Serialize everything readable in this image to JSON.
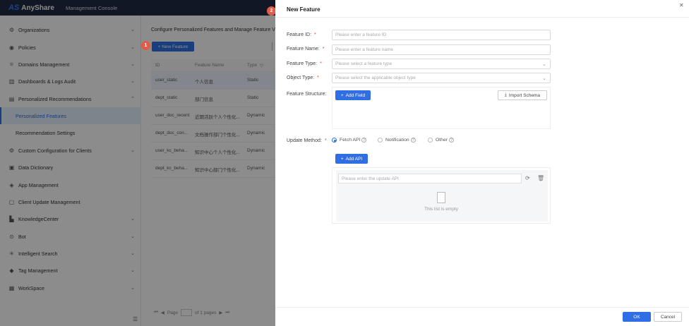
{
  "topbar": {
    "logo_mark": "AS",
    "brand": "AnyShare",
    "title": "Management Console"
  },
  "sidebar": {
    "items": [
      {
        "label": "Organizations",
        "icon": "organizations-icon",
        "expandable": true
      },
      {
        "label": "Policies",
        "icon": "policies-icon",
        "expandable": true
      },
      {
        "label": "Domains Management",
        "icon": "domains-icon",
        "expandable": true
      },
      {
        "label": "Dashboards & Logs Audit",
        "icon": "dashboard-icon",
        "expandable": true
      },
      {
        "label": "Personalized Recommendations",
        "icon": "recommendations-icon",
        "expandable": true,
        "expanded": true
      },
      {
        "label": "Personalized Features",
        "sub": true,
        "active": true
      },
      {
        "label": "Recommendation Settings",
        "sub": true
      },
      {
        "label": "Custom Configuration for Clients",
        "icon": "custom-config-icon",
        "expandable": true
      },
      {
        "label": "Data Dictionary",
        "icon": "dictionary-icon"
      },
      {
        "label": "App Management",
        "icon": "app-icon"
      },
      {
        "label": "Client Update Management",
        "icon": "client-update-icon"
      },
      {
        "label": "KnowledgeCenter",
        "icon": "knowledge-icon",
        "expandable": true
      },
      {
        "label": "Bot",
        "icon": "bot-icon",
        "expandable": true
      },
      {
        "label": "Intelligent Search",
        "icon": "search-icon",
        "expandable": true
      },
      {
        "label": "Tag Management",
        "icon": "tag-icon",
        "expandable": true
      },
      {
        "label": "WorkSpace",
        "icon": "workspace-icon",
        "expandable": true
      }
    ]
  },
  "main": {
    "heading": "Configure Personalized Features and Manage Feature V",
    "new_feature_label": "+ New Feature",
    "columns": [
      "ID",
      "Feature Name",
      "Type"
    ],
    "rows": [
      {
        "id": "user_static",
        "name": "个人信息",
        "type": "Static"
      },
      {
        "id": "dept_static",
        "name": "部门信息",
        "type": "Static"
      },
      {
        "id": "user_doc_recent",
        "name": "近期活跃个人个性化...",
        "type": "Dynamic"
      },
      {
        "id": "dept_doc_con...",
        "name": "文档操作部门个性化...",
        "type": "Dynamic"
      },
      {
        "id": "user_kc_beha...",
        "name": "知识中心个人个性化...",
        "type": "Dynamic"
      },
      {
        "id": "dept_kc_beha...",
        "name": "知识中心部门个性化...",
        "type": "Dynamic"
      }
    ],
    "pager": {
      "page_label": "Page",
      "of_label": "of 1 pages"
    }
  },
  "steps": {
    "one": "1",
    "two": "2"
  },
  "drawer": {
    "title": "New Feature",
    "fields": {
      "feature_id": {
        "label": "Feature ID:",
        "placeholder": "Please enter a feature ID"
      },
      "feature_name": {
        "label": "Feature Name:",
        "placeholder": "Please enter a feature name"
      },
      "feature_type": {
        "label": "Feature Type:",
        "placeholder": "Please select a feature type"
      },
      "object_type": {
        "label": "Object Type:",
        "placeholder": "Please select the applicable object type"
      }
    },
    "structure": {
      "label": "Feature Structure:",
      "add_field": "Add Field",
      "import_schema": "Import Schema"
    },
    "update_method": {
      "label": "Update Method:",
      "options": [
        {
          "label": "Fetch API",
          "selected": true
        },
        {
          "label": "Notification",
          "selected": false
        },
        {
          "label": "Other",
          "selected": false
        }
      ]
    },
    "api": {
      "add_api": "Add API",
      "placeholder": "Please enter the update API",
      "empty": "This list is empty"
    },
    "footer": {
      "ok": "OK",
      "cancel": "Cancel"
    }
  },
  "colors": {
    "accent": "#2f6fe3",
    "step": "#e25a4a",
    "topbar": "#1f2a44",
    "required": "#e54040"
  }
}
